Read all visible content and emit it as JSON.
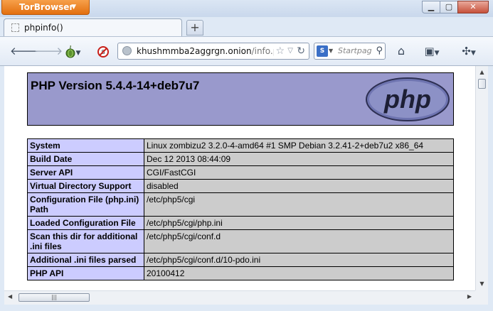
{
  "browser": {
    "menu_button": "TorBrowser",
    "tab_title": "phpinfo()",
    "new_tab": "+",
    "url_host": "khushmmba2aggrgn.onion",
    "url_path": "/info.p",
    "search_placeholder": "Startpag"
  },
  "page": {
    "heading": "PHP Version 5.4.4-14+deb7u7",
    "logo_text": "php",
    "rows": [
      {
        "key": "System",
        "value": "Linux zombizu2 3.2.0-4-amd64 #1 SMP Debian 3.2.41-2+deb7u2 x86_64"
      },
      {
        "key": "Build Date",
        "value": "Dec 12 2013 08:44:09"
      },
      {
        "key": "Server API",
        "value": "CGI/FastCGI"
      },
      {
        "key": "Virtual Directory Support",
        "value": "disabled"
      },
      {
        "key": "Configuration File (php.ini) Path",
        "value": "/etc/php5/cgi"
      },
      {
        "key": "Loaded Configuration File",
        "value": "/etc/php5/cgi/php.ini"
      },
      {
        "key": "Scan this dir for additional .ini files",
        "value": "/etc/php5/cgi/conf.d"
      },
      {
        "key": "Additional .ini files parsed",
        "value": "/etc/php5/cgi/conf.d/10-pdo.ini"
      },
      {
        "key": "PHP API",
        "value": "20100412"
      }
    ]
  },
  "colors": {
    "header_bg": "#9999cc",
    "key_bg": "#ccccff",
    "value_bg": "#cccccc",
    "tor_button": "#e36f0f"
  }
}
